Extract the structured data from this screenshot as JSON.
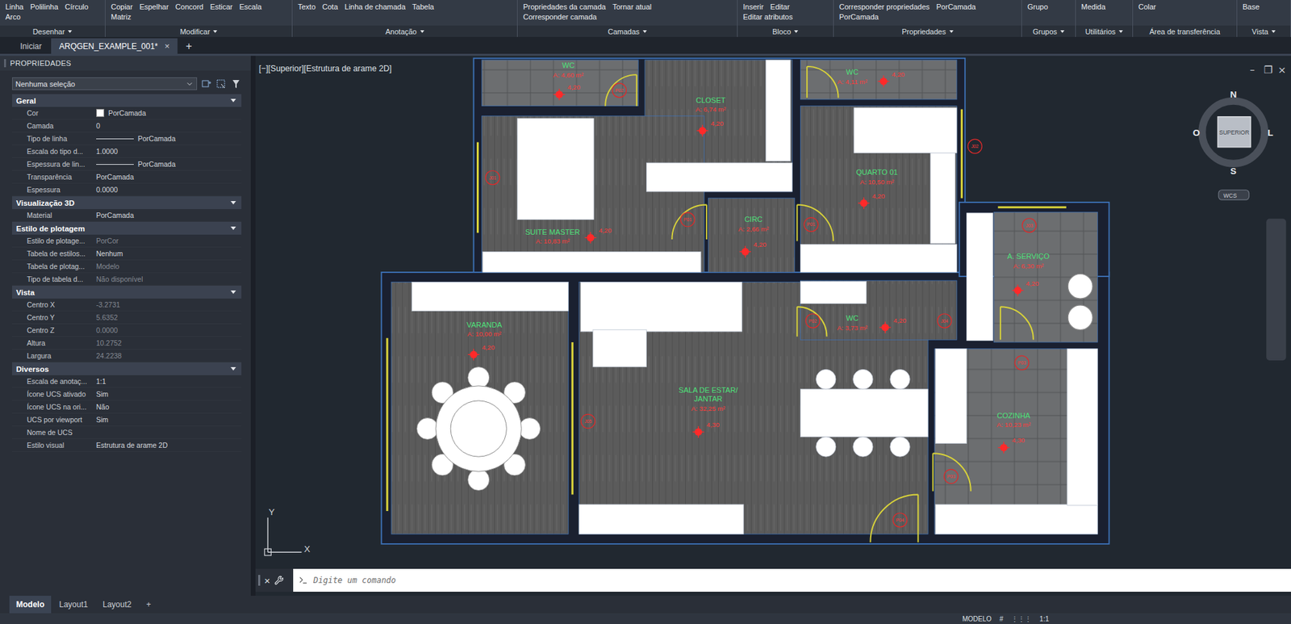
{
  "window": {
    "title": "ARQGEN_EXAMPLE_001*"
  },
  "ribbon": {
    "panels": [
      {
        "title": "Desenhar",
        "menu": true,
        "tools": [
          "Linha",
          "Polilinha",
          "Círculo",
          "Arco"
        ]
      },
      {
        "title": "Modificar",
        "menu": true,
        "tools": [
          "Copiar",
          "Espelhar",
          "Concord",
          "Esticar",
          "Escala",
          "Matriz"
        ]
      },
      {
        "title": "Anotação",
        "menu": true,
        "tools": [
          "Texto",
          "Cota",
          "Linha de chamada",
          "Tabela"
        ]
      },
      {
        "title": "Camadas",
        "menu": true,
        "tools": [
          "Propriedades da camada",
          "Tornar atual",
          "Corresponder camada"
        ]
      },
      {
        "title": "Bloco",
        "menu": true,
        "tools": [
          "Inserir",
          "Editar",
          "Editar atributos"
        ]
      },
      {
        "title": "Propriedades",
        "menu": true,
        "tools": [
          "Corresponder propriedades",
          "PorCamada",
          "PorCamada"
        ]
      },
      {
        "title": "Grupos",
        "menu": true,
        "tools": [
          "Grupo"
        ]
      },
      {
        "title": "Utilitários",
        "menu": true,
        "tools": [
          "Medida"
        ]
      },
      {
        "title": "Área de transferência",
        "menu": false,
        "tools": [
          "Colar"
        ]
      },
      {
        "title": "Vista",
        "menu": true,
        "tools": [
          "Base"
        ]
      }
    ]
  },
  "file_tabs": {
    "tabs": [
      {
        "label": "Iniciar",
        "selected": false,
        "closable": false
      },
      {
        "label": "ARQGEN_EXAMPLE_001*",
        "selected": true,
        "closable": true
      }
    ],
    "close": "×",
    "add": "+"
  },
  "properties": {
    "title": "PROPRIEDADES",
    "selection": "Nenhuma seleção",
    "sections": [
      {
        "title": "Geral",
        "expanded": true,
        "rows": [
          {
            "label": "Cor",
            "value": "PorCamada",
            "kind": "swatch",
            "disabled": false
          },
          {
            "label": "Camada",
            "value": "0",
            "kind": "text",
            "disabled": false
          },
          {
            "label": "Tipo de linha",
            "value": "PorCamada",
            "kind": "line",
            "disabled": false
          },
          {
            "label": "Escala do tipo d...",
            "value": "1.0000",
            "kind": "text",
            "disabled": false
          },
          {
            "label": "Espessura de lin...",
            "value": "PorCamada",
            "kind": "line",
            "disabled": false
          },
          {
            "label": "Transparência",
            "value": "PorCamada",
            "kind": "text",
            "disabled": false
          },
          {
            "label": "Espessura",
            "value": "0.0000",
            "kind": "text",
            "disabled": false
          }
        ]
      },
      {
        "title": "Visualização 3D",
        "expanded": true,
        "rows": [
          {
            "label": "Material",
            "value": "PorCamada",
            "kind": "text",
            "disabled": false
          }
        ]
      },
      {
        "title": "Estilo de plotagem",
        "expanded": true,
        "rows": [
          {
            "label": "Estilo de plotage...",
            "value": "PorCor",
            "kind": "text",
            "disabled": true
          },
          {
            "label": "Tabela de estilos...",
            "value": "Nenhum",
            "kind": "text",
            "disabled": false
          },
          {
            "label": "Tabela de plotag...",
            "value": "Modelo",
            "kind": "text",
            "disabled": true
          },
          {
            "label": "Tipo de tabela d...",
            "value": "Não disponível",
            "kind": "text",
            "disabled": true
          }
        ]
      },
      {
        "title": "Vista",
        "expanded": true,
        "rows": [
          {
            "label": "Centro X",
            "value": "-3.2731",
            "kind": "text",
            "disabled": true
          },
          {
            "label": "Centro Y",
            "value": "5.6352",
            "kind": "text",
            "disabled": true
          },
          {
            "label": "Centro Z",
            "value": "0.0000",
            "kind": "text",
            "disabled": true
          },
          {
            "label": "Altura",
            "value": "10.2752",
            "kind": "text",
            "disabled": true
          },
          {
            "label": "Largura",
            "value": "24.2238",
            "kind": "text",
            "disabled": true
          }
        ]
      },
      {
        "title": "Diversos",
        "expanded": true,
        "rows": [
          {
            "label": "Escala de anotaç...",
            "value": "1:1",
            "kind": "text",
            "disabled": false
          },
          {
            "label": "Ícone UCS ativado",
            "value": "Sim",
            "kind": "text",
            "disabled": false
          },
          {
            "label": "Ícone UCS na ori...",
            "value": "Não",
            "kind": "text",
            "disabled": false
          },
          {
            "label": "UCS por viewport",
            "value": "Sim",
            "kind": "text",
            "disabled": false
          },
          {
            "label": "Nome de UCS",
            "value": "",
            "kind": "text",
            "disabled": false
          },
          {
            "label": "Estilo visual",
            "value": "Estrutura de arame 2D",
            "kind": "text",
            "disabled": false
          }
        ]
      }
    ]
  },
  "viewport": {
    "label": "[−][Superior][Estrutura de arame 2D]",
    "controls": [
      "–",
      "❐",
      "×"
    ],
    "viewcube": {
      "face": "SUPERIOR",
      "north": "N",
      "south": "S",
      "east": "L",
      "west": "O",
      "ucs": "WCS"
    },
    "ucs_axes": {
      "x": "X",
      "y": "Y"
    },
    "rooms": [
      {
        "name": [
          "WC"
        ],
        "area": "A: 4,60 m²",
        "level": "4,20",
        "floor": "tile"
      },
      {
        "name": [
          "CLOSET"
        ],
        "area": "A: 6,74 m²",
        "level": "4,20",
        "floor": "wood"
      },
      {
        "name": [
          "WC"
        ],
        "area": "A: 4,11 m²",
        "level": "4,20",
        "floor": "tile"
      },
      {
        "name": [
          "SUITE MASTER"
        ],
        "area": "A: 10,83 m²",
        "level": "4,20",
        "floor": "wood"
      },
      {
        "name": [
          "CIRC"
        ],
        "area": "A: 2,66 m²",
        "level": "4,20",
        "floor": "wood"
      },
      {
        "name": [
          "QUARTO 01"
        ],
        "area": "A: 10,50 m²",
        "level": "4,20",
        "floor": "wood"
      },
      {
        "name": [
          "A. SERVIÇO"
        ],
        "area": "A: 6,30 m²",
        "level": "4,20",
        "floor": "tile"
      },
      {
        "name": [
          "WC"
        ],
        "area": "A: 3,73 m²",
        "level": "4,20",
        "floor": "wood"
      },
      {
        "name": [
          "VARANDA"
        ],
        "area": "A: 10,00 m²",
        "level": "4,20",
        "floor": "wood"
      },
      {
        "name": [
          "SALA DE ESTAR/",
          "JANTAR"
        ],
        "area": "A: 32,25 m²",
        "level": "4,30",
        "floor": "wood"
      },
      {
        "name": [
          "COZINHA"
        ],
        "area": "A: 10,23 m²",
        "level": "4,30",
        "floor": "tile"
      }
    ],
    "tags": [
      "P02",
      "J01",
      "P01",
      "P01",
      "J02",
      "J03",
      "P02",
      "J04",
      "J05",
      "P03",
      "P03",
      "P04"
    ]
  },
  "command": {
    "close": "×",
    "placeholder": "Digite um comando"
  },
  "layout_tabs": {
    "tabs": [
      {
        "label": "Modelo",
        "selected": true
      },
      {
        "label": "Layout1",
        "selected": false
      },
      {
        "label": "Layout2",
        "selected": false
      }
    ],
    "add": "+"
  },
  "status_bar": {
    "items": [
      "MODELO",
      "#",
      "⋮⋮⋮",
      "1:1"
    ]
  }
}
